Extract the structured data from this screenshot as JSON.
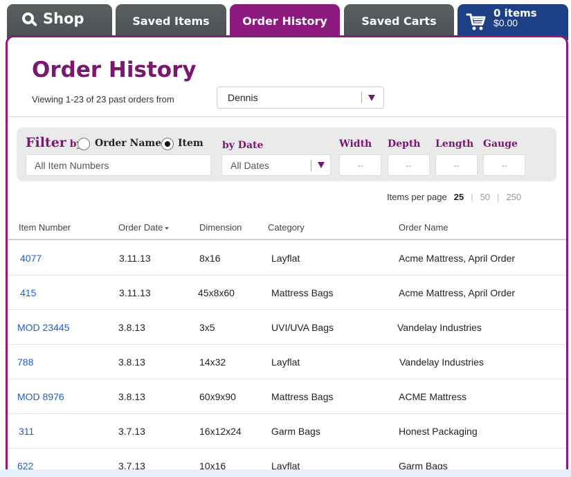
{
  "tabs": {
    "shop": "Shop",
    "saved_items": "Saved Items",
    "order_history": "Order History",
    "saved_carts": "Saved Carts",
    "cart_count": "0 items",
    "cart_total": "$0.00"
  },
  "page": {
    "title": "Order History",
    "viewing_text": "Viewing 1-23 of 23 past orders from",
    "user_selected": "Dennis"
  },
  "filter": {
    "filter_label": "Filter",
    "by_label": "by",
    "option_order_name": "Order Name",
    "option_item": "Item",
    "item_placeholder": "All Item Numbers",
    "by_date_label": "by Date",
    "date_selected": "All Dates",
    "width_label": "Width",
    "depth_label": "Depth",
    "length_label": "Length",
    "gauge_label": "Gauge",
    "width_value": "--",
    "depth_value": "--",
    "length_value": "--",
    "gauge_value": "--"
  },
  "pager": {
    "label": "Items per page",
    "options": [
      "25",
      "50",
      "250"
    ],
    "separator": "|"
  },
  "table": {
    "headers": {
      "item_number": "Item Number",
      "order_date": "Order Date",
      "dimension": "Dimension",
      "category": "Category",
      "order_name": "Order Name"
    },
    "rows": [
      {
        "item": "4077",
        "date": "3.11.13",
        "dimension": "8x16",
        "category": "Layflat",
        "order_name": "Acme Mattress, April Order"
      },
      {
        "item": "415",
        "date": "3.11.13",
        "dimension": "45x8x60",
        "category": "Mattress Bags",
        "order_name": "Acme Mattress, April Order"
      },
      {
        "item": "MOD 23445",
        "date": "3.8.13",
        "dimension": "3x5",
        "category": "UVI/UVA Bags",
        "order_name": "Vandelay Industries"
      },
      {
        "item": "788",
        "date": "3.8.13",
        "dimension": "14x32",
        "category": "Layflat",
        "order_name": "Vandelay Industries"
      },
      {
        "item": "MOD 8976",
        "date": "3.8.13",
        "dimension": "60x9x90",
        "category": "Mattress Bags",
        "order_name": "ACME Mattress"
      },
      {
        "item": "311",
        "date": "3.7.13",
        "dimension": "16x12x24",
        "category": "Garm Bags",
        "order_name": "Honest Packaging"
      },
      {
        "item": "622",
        "date": "3.7.13",
        "dimension": "10x16",
        "category": "Layflat",
        "order_name": "Garm Bags"
      }
    ]
  },
  "colors": {
    "accent_purple": "#8c1a7e",
    "tab_gray": "#4f5456",
    "cart_blue": "#1c3f86",
    "link_blue": "#1f5fbf"
  }
}
